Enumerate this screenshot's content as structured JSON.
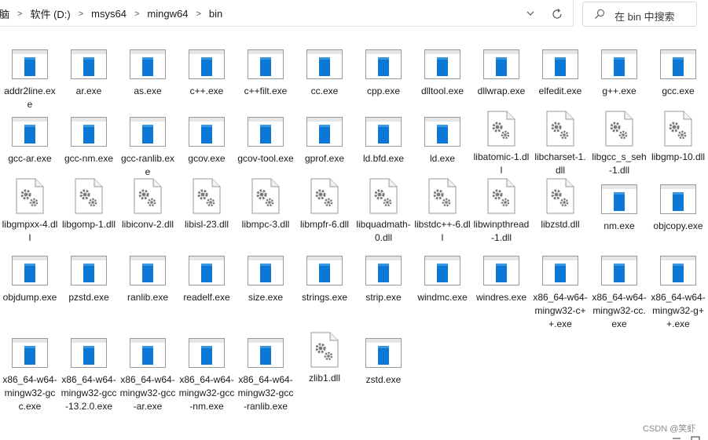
{
  "address_bar": {
    "breadcrumbs": [
      "脑",
      "软件 (D:)",
      "msys64",
      "mingw64",
      "bin"
    ],
    "separator": ">"
  },
  "search": {
    "placeholder": "在 bin 中搜索"
  },
  "watermark": "CSDN @笑虾",
  "colors": {
    "exe_icon": "#0a78d4",
    "dll_gear": "#7a7a7a",
    "text": "#1a1a1a"
  },
  "files": [
    {
      "name": "addr2line.exe",
      "type": "exe"
    },
    {
      "name": "ar.exe",
      "type": "exe"
    },
    {
      "name": "as.exe",
      "type": "exe"
    },
    {
      "name": "c++.exe",
      "type": "exe"
    },
    {
      "name": "c++filt.exe",
      "type": "exe"
    },
    {
      "name": "cc.exe",
      "type": "exe"
    },
    {
      "name": "cpp.exe",
      "type": "exe"
    },
    {
      "name": "dlltool.exe",
      "type": "exe"
    },
    {
      "name": "dllwrap.exe",
      "type": "exe"
    },
    {
      "name": "elfedit.exe",
      "type": "exe"
    },
    {
      "name": "g++.exe",
      "type": "exe"
    },
    {
      "name": "gcc.exe",
      "type": "exe"
    },
    {
      "name": "gcc-ar.exe",
      "type": "exe"
    },
    {
      "name": "gcc-nm.exe",
      "type": "exe"
    },
    {
      "name": "gcc-ranlib.exe",
      "type": "exe"
    },
    {
      "name": "gcov.exe",
      "type": "exe"
    },
    {
      "name": "gcov-tool.exe",
      "type": "exe"
    },
    {
      "name": "gprof.exe",
      "type": "exe"
    },
    {
      "name": "ld.bfd.exe",
      "type": "exe"
    },
    {
      "name": "ld.exe",
      "type": "exe"
    },
    {
      "name": "libatomic-1.dll",
      "type": "dll"
    },
    {
      "name": "libcharset-1.dll",
      "type": "dll"
    },
    {
      "name": "libgcc_s_seh-1.dll",
      "type": "dll"
    },
    {
      "name": "libgmp-10.dll",
      "type": "dll"
    },
    {
      "name": "libgmpxx-4.dll",
      "type": "dll"
    },
    {
      "name": "libgomp-1.dll",
      "type": "dll"
    },
    {
      "name": "libiconv-2.dll",
      "type": "dll"
    },
    {
      "name": "libisl-23.dll",
      "type": "dll"
    },
    {
      "name": "libmpc-3.dll",
      "type": "dll"
    },
    {
      "name": "libmpfr-6.dll",
      "type": "dll"
    },
    {
      "name": "libquadmath-0.dll",
      "type": "dll"
    },
    {
      "name": "libstdc++-6.dll",
      "type": "dll"
    },
    {
      "name": "libwinpthread-1.dll",
      "type": "dll"
    },
    {
      "name": "libzstd.dll",
      "type": "dll"
    },
    {
      "name": "nm.exe",
      "type": "exe"
    },
    {
      "name": "objcopy.exe",
      "type": "exe"
    },
    {
      "name": "objdump.exe",
      "type": "exe"
    },
    {
      "name": "pzstd.exe",
      "type": "exe"
    },
    {
      "name": "ranlib.exe",
      "type": "exe"
    },
    {
      "name": "readelf.exe",
      "type": "exe"
    },
    {
      "name": "size.exe",
      "type": "exe"
    },
    {
      "name": "strings.exe",
      "type": "exe"
    },
    {
      "name": "strip.exe",
      "type": "exe"
    },
    {
      "name": "windmc.exe",
      "type": "exe"
    },
    {
      "name": "windres.exe",
      "type": "exe"
    },
    {
      "name": "x86_64-w64-mingw32-c++.exe",
      "type": "exe"
    },
    {
      "name": "x86_64-w64-mingw32-cc.exe",
      "type": "exe"
    },
    {
      "name": "x86_64-w64-mingw32-g++.exe",
      "type": "exe"
    },
    {
      "name": "x86_64-w64-mingw32-gcc.exe",
      "type": "exe"
    },
    {
      "name": "x86_64-w64-mingw32-gcc-13.2.0.exe",
      "type": "exe"
    },
    {
      "name": "x86_64-w64-mingw32-gcc-ar.exe",
      "type": "exe"
    },
    {
      "name": "x86_64-w64-mingw32-gcc-nm.exe",
      "type": "exe"
    },
    {
      "name": "x86_64-w64-mingw32-gcc-ranlib.exe",
      "type": "exe"
    },
    {
      "name": "zlib1.dll",
      "type": "dll"
    },
    {
      "name": "zstd.exe",
      "type": "exe"
    }
  ]
}
